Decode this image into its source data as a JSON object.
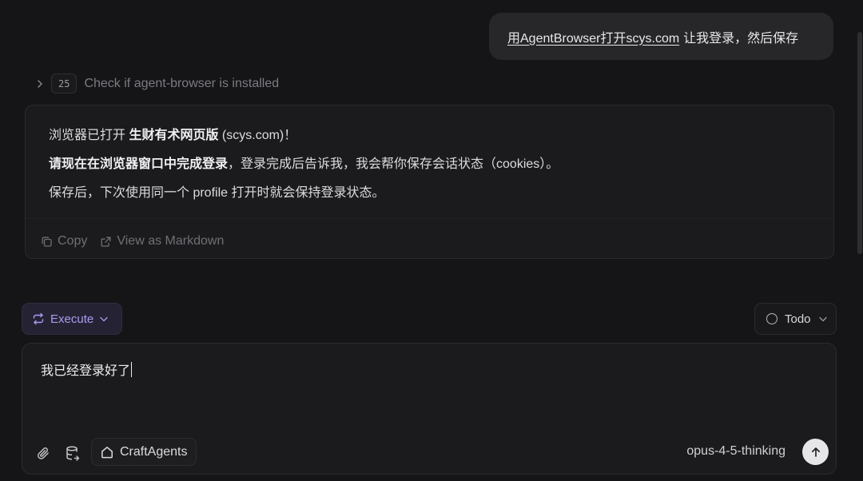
{
  "user_message": {
    "link_text": "用AgentBrowser打开scys.com",
    "rest_text": "让我登录，然后保存"
  },
  "tool_call": {
    "count": "25",
    "label": "Check if agent-browser is installed"
  },
  "assistant": {
    "line1_pre": "浏览器已打开 ",
    "line1_bold": "生财有术网页版",
    "line1_post": " (scys.com)！",
    "line2_bold": "请现在在浏览器窗口中完成登录",
    "line2_post": "，登录完成后告诉我，我会帮你保存会话状态（cookies）。",
    "line3": "保存后，下次使用同一个 profile 打开时就会保持登录状态。",
    "copy_label": "Copy",
    "markdown_label": "View as Markdown"
  },
  "mode": {
    "execute_label": "Execute",
    "todo_label": "Todo"
  },
  "composer": {
    "input_value": "我已经登录好了",
    "agent_label": "CraftAgents",
    "model_label": "opus-4-5-thinking"
  },
  "colors": {
    "background": "#151517",
    "accent_execute": "#a99cf0",
    "send_button": "#e6e6e9"
  }
}
